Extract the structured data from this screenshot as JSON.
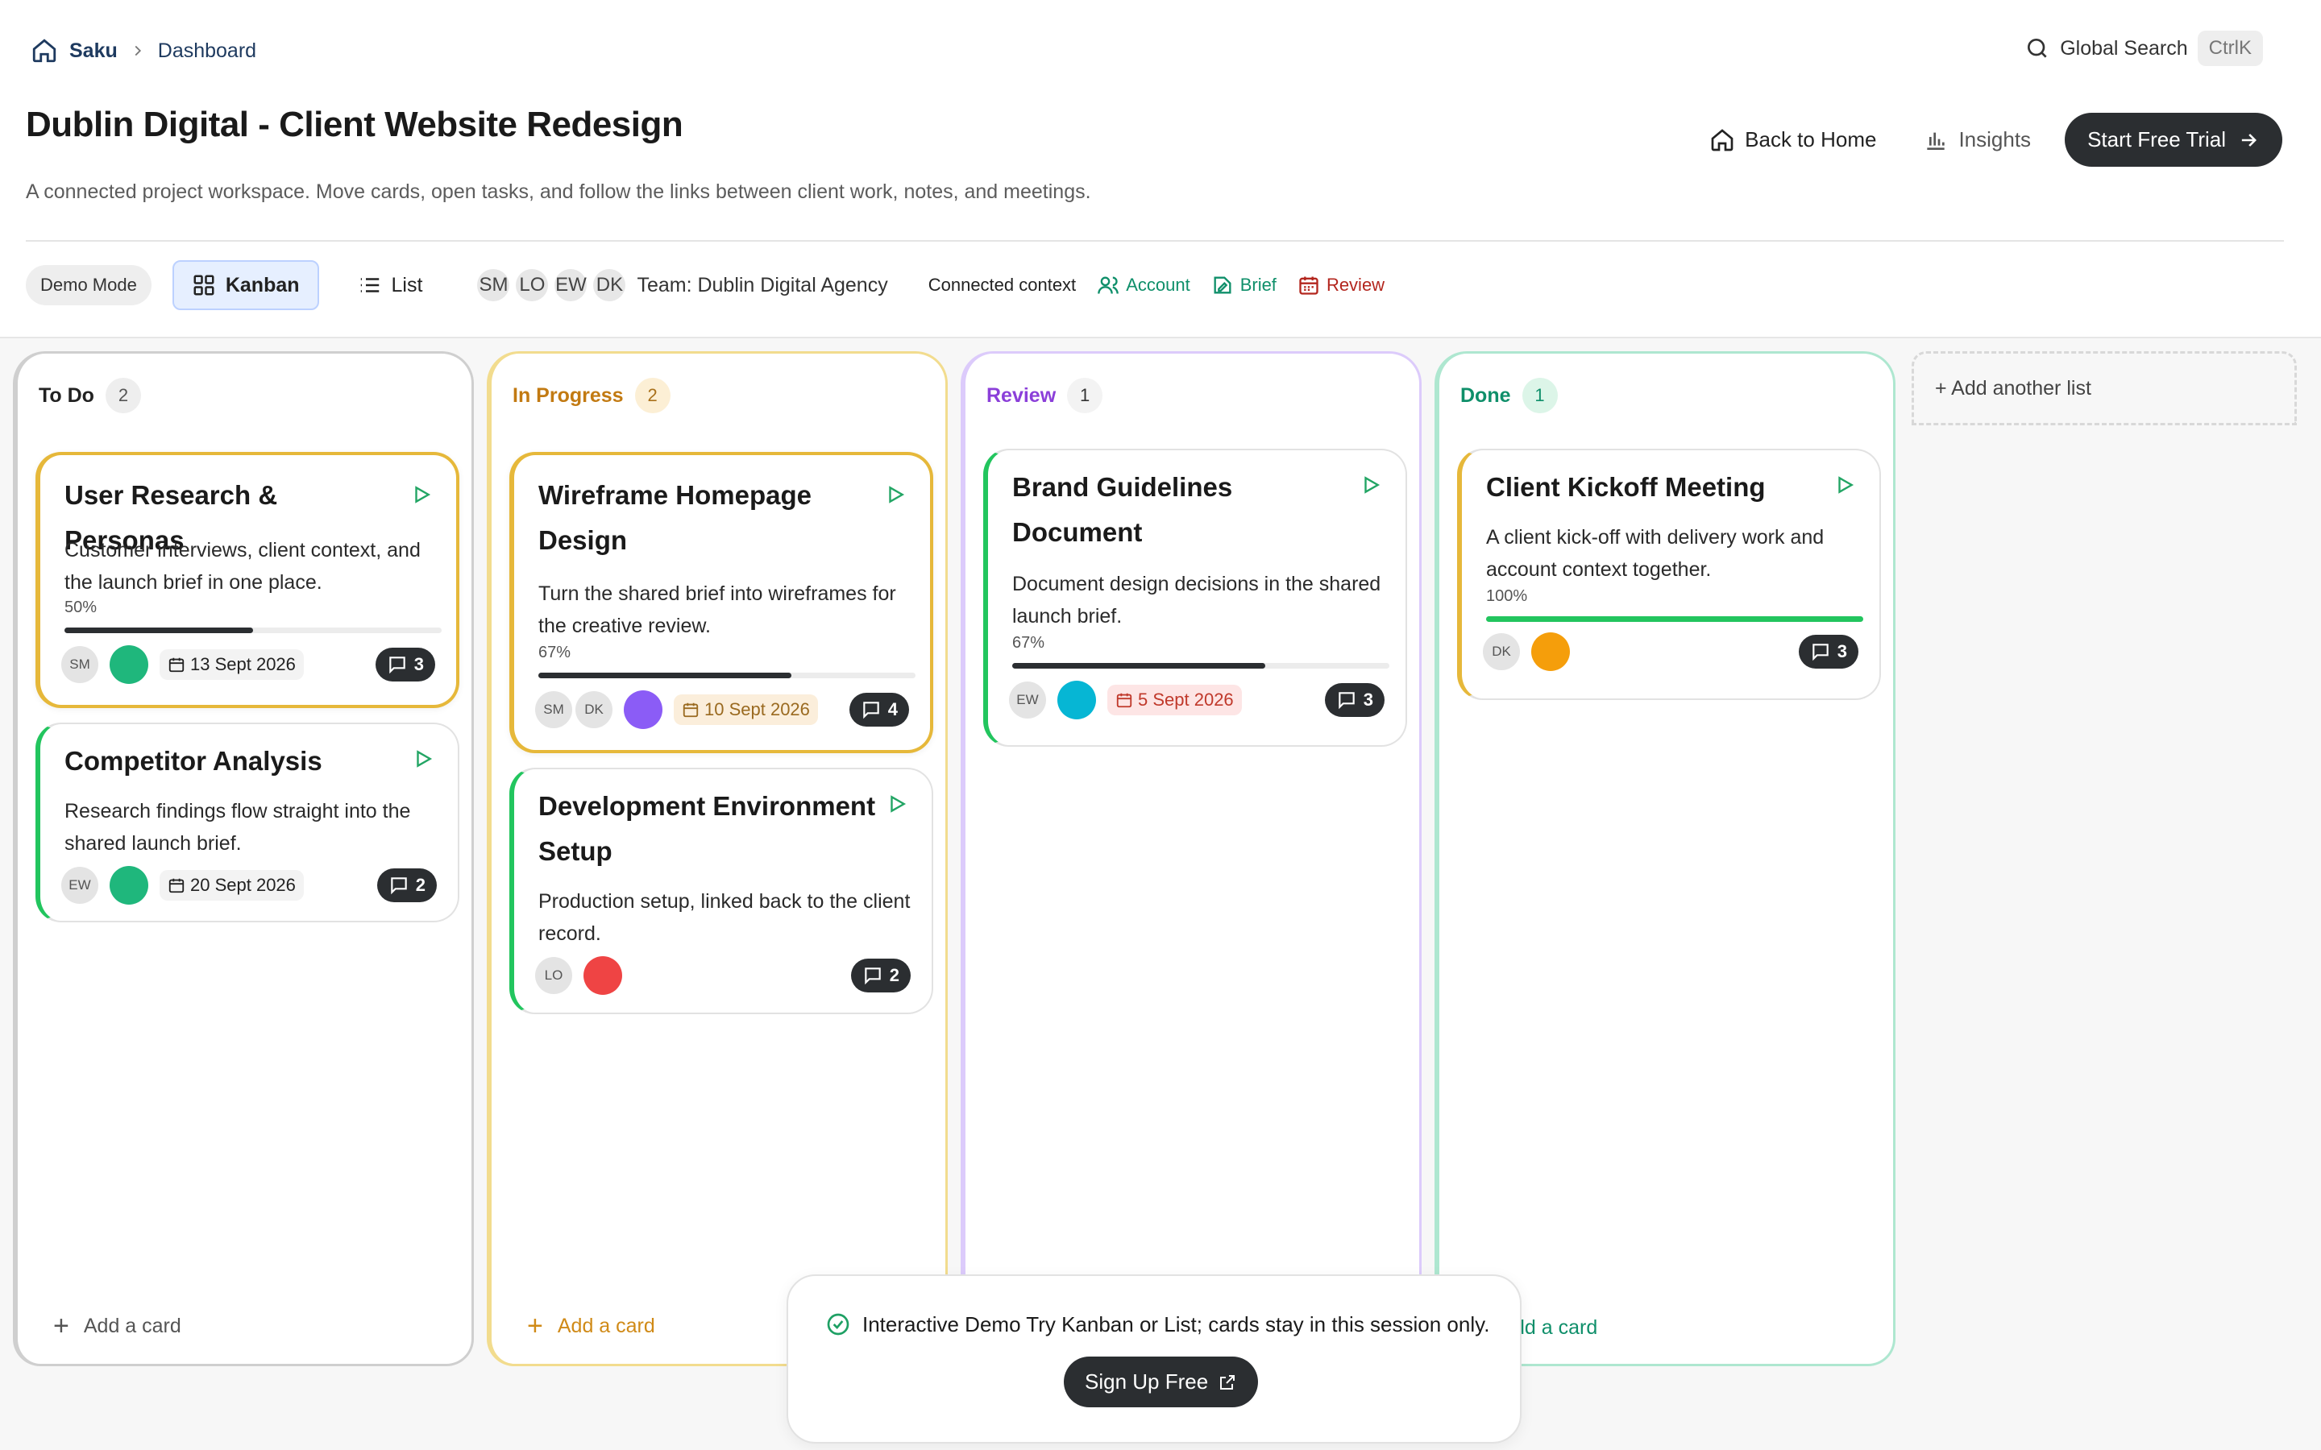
{
  "breadcrumb": {
    "brand": "Saku",
    "current": "Dashboard"
  },
  "search": {
    "label": "Global Search",
    "shortcut": "CtrlK"
  },
  "page": {
    "title": "Dublin Digital - Client Website Redesign",
    "subtitle": "A connected project workspace. Move cards, open tasks, and follow the links between client work, notes, and meetings."
  },
  "actions": {
    "back_home": "Back to Home",
    "insights": "Insights",
    "trial": "Start Free Trial"
  },
  "toolbar": {
    "demo_mode": "Demo Mode",
    "tab_kanban": "Kanban",
    "tab_list": "List",
    "team_initials": [
      "SM",
      "LO",
      "EW",
      "DK"
    ],
    "team_label": "Team: Dublin Digital Agency",
    "context_label": "Connected context",
    "ctx_account": "Account",
    "ctx_brief": "Brief",
    "ctx_review": "Review"
  },
  "columns": [
    {
      "name": "To Do",
      "count": "2",
      "add_label": "Add a card",
      "cards": [
        {
          "title": "User Research & Personas",
          "desc": "Customer interviews, client context, and the launch brief in one place.",
          "progress_label": "50%",
          "progress": 0.5,
          "assignee": "SM",
          "date": "13 Sept 2026",
          "comments": "3"
        },
        {
          "title": "Competitor Analysis",
          "desc": "Research findings flow straight into the shared launch brief.",
          "assignee": "EW",
          "date": "20 Sept 2026",
          "comments": "2"
        }
      ]
    },
    {
      "name": "In Progress",
      "count": "2",
      "add_label": "Add a card",
      "cards": [
        {
          "title": "Wireframe Homepage Design",
          "desc": "Turn the shared brief into wireframes for the creative review.",
          "progress_label": "67%",
          "progress": 0.67,
          "assignees": [
            "SM",
            "DK"
          ],
          "date": "10 Sept 2026",
          "comments": "4"
        },
        {
          "title": "Development Environment Setup",
          "desc": "Production setup, linked back to the client record.",
          "assignee": "LO",
          "comments": "2"
        }
      ]
    },
    {
      "name": "Review",
      "count": "1",
      "cards": [
        {
          "title": "Brand Guidelines Document",
          "desc": "Document design decisions in the shared launch brief.",
          "progress_label": "67%",
          "progress": 0.67,
          "assignee": "EW",
          "date": "5 Sept 2026",
          "comments": "3"
        }
      ]
    },
    {
      "name": "Done",
      "count": "1",
      "add_label": "dd a card",
      "cards": [
        {
          "title": "Client Kickoff Meeting",
          "desc": "A client kick-off with delivery work and account context together.",
          "progress_label": "100%",
          "progress": 1.0,
          "assignee": "DK",
          "comments": "3"
        }
      ]
    }
  ],
  "add_list": "+ Add another list",
  "toast": {
    "message": "Interactive Demo Try Kanban or List; cards stay in this session only.",
    "button": "Sign Up Free"
  },
  "colors": {
    "todo": "#c9c9c9",
    "in_progress": "#f2dc8e",
    "review": "#dccbfb",
    "done": "#aee7d0",
    "accent_green": "#22c55e",
    "bar_dark": "#2b2e31",
    "highlight": "#e6b83a"
  }
}
